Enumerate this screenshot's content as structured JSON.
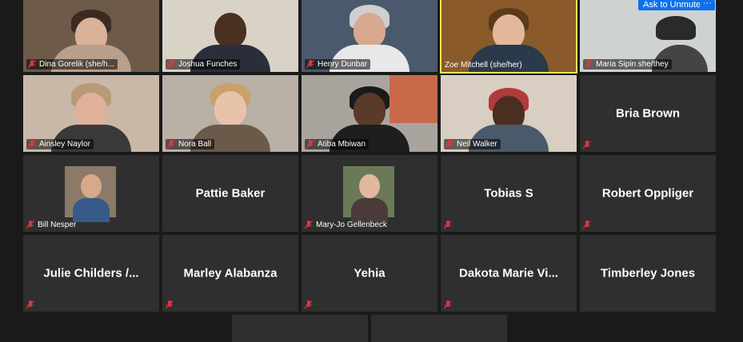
{
  "controls": {
    "ask_to_unmute": "Ask to Unmute",
    "more": "···"
  },
  "colors": {
    "tile_bg": "#2f2f2f",
    "page_bg": "#1a1a1a",
    "active_speaker_border": "#f5e65a",
    "muted_icon": "#e0353e",
    "accent": "#0e71eb"
  },
  "participants": [
    {
      "name": "Dina Gorelik (she/h...",
      "video": true,
      "muted": true
    },
    {
      "name": "Joshua Funches",
      "video": true,
      "muted": true
    },
    {
      "name": "Henry Dunbar",
      "video": true,
      "muted": true
    },
    {
      "name": "Zoe Mitchell (she/her)",
      "video": true,
      "muted": false,
      "active_speaker": true
    },
    {
      "name": "Maria Sipin she/they",
      "video": true,
      "muted": true
    },
    {
      "name": "Ainsley Naylor",
      "video": true,
      "muted": true
    },
    {
      "name": "Nora Ball",
      "video": true,
      "muted": true
    },
    {
      "name": "Atiba Mbiwan",
      "video": true,
      "muted": true
    },
    {
      "name": "Neil Walker",
      "video": true,
      "muted": true
    },
    {
      "name": "Bria Brown",
      "video": false,
      "muted": true
    },
    {
      "name": "Bill Nesper",
      "video": false,
      "avatar": true,
      "muted": true
    },
    {
      "name": "Pattie Baker",
      "video": false,
      "muted": false
    },
    {
      "name": "Mary-Jo Gellenbeck",
      "video": false,
      "avatar": true,
      "muted": true
    },
    {
      "name": "Tobias S",
      "video": false,
      "muted": true
    },
    {
      "name": "Robert Oppliger",
      "video": false,
      "muted": true
    },
    {
      "name": "Julie  Childers  /...",
      "video": false,
      "muted": true
    },
    {
      "name": "Marley Alabanza",
      "video": false,
      "muted": true
    },
    {
      "name": "Yehia",
      "video": false,
      "muted": true
    },
    {
      "name": "Dakota  Marie  Vi...",
      "video": false,
      "muted": true
    },
    {
      "name": "Timberley Jones",
      "video": false,
      "muted": true
    }
  ]
}
